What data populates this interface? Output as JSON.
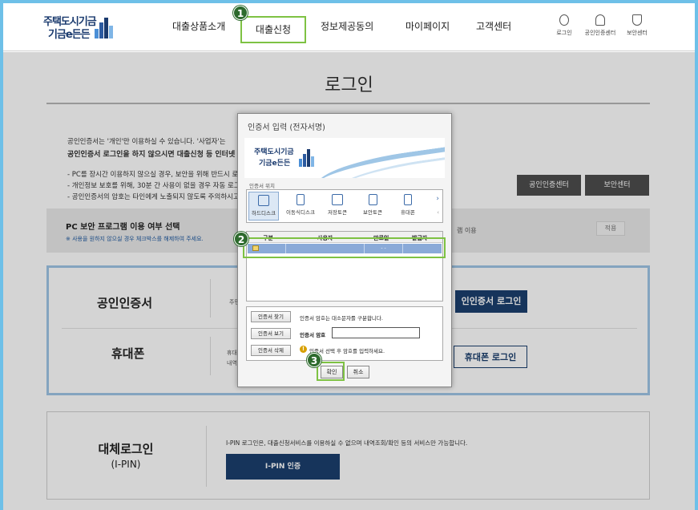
{
  "header": {
    "logo_line1": "주택도시기금",
    "logo_line2": "기금e든든",
    "nav": [
      "대출상품소개",
      "대출신청",
      "정보제공동의",
      "마이페이지",
      "고객센터"
    ],
    "active_nav": "대출신청",
    "utils": [
      "로그인",
      "공인인증센터",
      "보안센터"
    ]
  },
  "badges": [
    "1",
    "2",
    "3"
  ],
  "page": {
    "title": "로그인",
    "info_line1": "공인인증서는 '개인'만 이용하실 수 있습니다. '사업자'는",
    "info_line2": "공인인증서 로그인을 하지 않으시면 대출신청 등 인터넷",
    "bullet1": "- PC를 장시간 이용하지 않으실 경우, 보안을 위해 반드시 로그아",
    "bullet2": "- 개인정보 보호를 위해, 30분 간 사용이 없을 경우 자동 로그아웃",
    "bullet3": "- 공인인증서의 암호는 타인에게 노출되지 않도록 주의하시고 주",
    "cert_center_btn": "공인인증센터",
    "security_center_btn": "보안센터",
    "pc_title": "PC 보안 프로그램 이용 여부 선택",
    "pc_note": "※ 사용을 원하지 않으실 경우 체크박스를 해제하여 주세요.",
    "pc_option": "램 이용",
    "pc_apply": "적용",
    "cert_label": "공인인증서",
    "cert_sub": "주민",
    "cert_login_btn": "인인증서 로그인",
    "phone_label": "휴대폰",
    "phone_sub1": "휴대",
    "phone_sub2": "내역",
    "phone_login_btn": "휴대폰 로그인",
    "alt_label": "대체로그인",
    "alt_sub": "(I-PIN)",
    "alt_desc": "I-PIN 로그인은, 대출신청서비스를 이용하실 수 없으며 내역조회/확인 등의 서비스만 가능합니다.",
    "ipin_btn": "I-PIN 인증"
  },
  "dialog": {
    "title": "인증서 입력 (전자서명)",
    "banner_line1": "주택도시기금",
    "banner_line2": "기금e든든",
    "location_label": "인증서 위치",
    "locations": [
      "하드디스크",
      "이동식디스크",
      "저장토큰",
      "보안토큰",
      "휴대폰"
    ],
    "table_headers": [
      "구분",
      "사용자",
      "만료일",
      "발급자"
    ],
    "table_row": [
      "",
      "",
      "- -",
      ""
    ],
    "find_btn": "인증서 찾기",
    "find_note": "인증서 암호는 대소문자를 구분합니다.",
    "view_btn": "인증서 보기",
    "pw_label": "인증서 암호",
    "pw_value": "",
    "delete_btn": "인증서 삭제",
    "warn_note": "인증서 선택 후 암호를 입력하세요.",
    "ok_btn": "확인",
    "cancel_btn": "취소"
  }
}
